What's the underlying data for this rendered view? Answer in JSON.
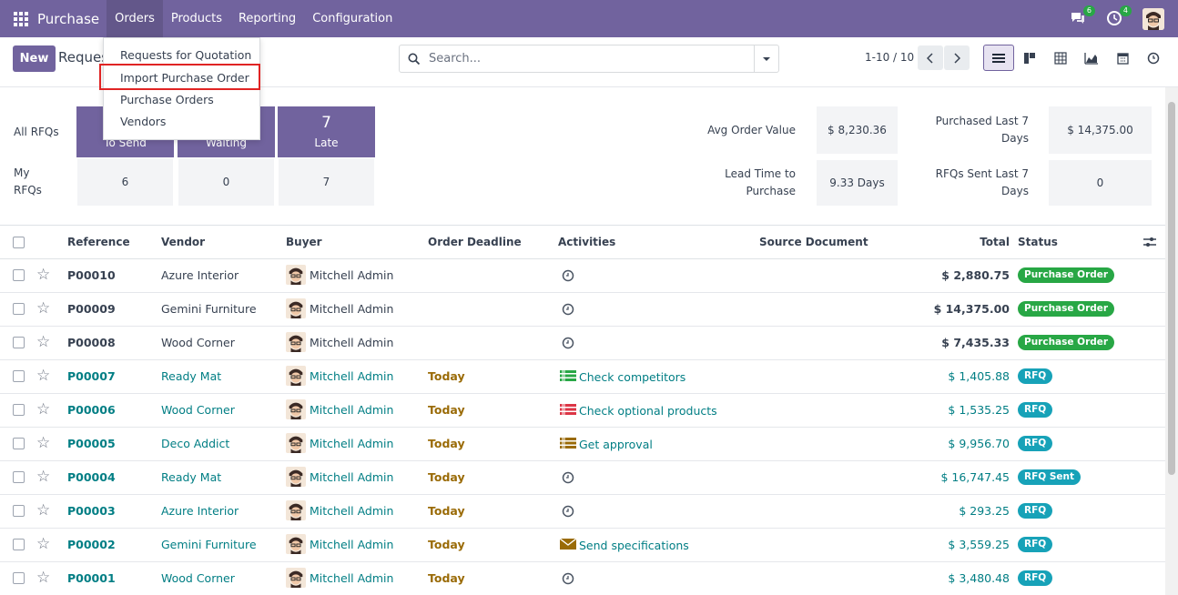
{
  "navbar": {
    "brand": "Purchase",
    "menu": [
      "Orders",
      "Products",
      "Reporting",
      "Configuration"
    ],
    "messages_count": "6",
    "activities_count": "4"
  },
  "control": {
    "new_label": "New",
    "title": "Reques",
    "search_placeholder": "Search...",
    "pager": "1-10 / 10"
  },
  "dropdown": {
    "items": [
      "Requests for Quotation",
      "Import Purchase Order",
      "Purchase Orders",
      "Vendors"
    ]
  },
  "dashboard": {
    "all_rfqs_label": "All RFQs",
    "my_rfqs_label": "My RFQs",
    "tiles": [
      {
        "count": "",
        "label": "To Send"
      },
      {
        "count": "",
        "label": "Waiting"
      },
      {
        "count": "7",
        "label": "Late"
      }
    ],
    "my_values": [
      "6",
      "0",
      "7"
    ],
    "kpis": [
      {
        "label": "Avg Order Value",
        "value": "$ 8,230.36"
      },
      {
        "label": "Purchased Last 7 Days",
        "value": "$ 14,375.00"
      },
      {
        "label": "Lead Time to Purchase",
        "value": "9.33 Days"
      },
      {
        "label": "RFQs Sent Last 7 Days",
        "value": "0"
      }
    ]
  },
  "table": {
    "headers": [
      "Reference",
      "Vendor",
      "Buyer",
      "Order Deadline",
      "Activities",
      "Source Document",
      "Total",
      "Status"
    ],
    "rows": [
      {
        "ref": "P00010",
        "vendor": "Azure Interior",
        "buyer": "Mitchell Admin",
        "deadline": "",
        "activity": "",
        "total": "$ 2,880.75",
        "status": "Purchase Order"
      },
      {
        "ref": "P00009",
        "vendor": "Gemini Furniture",
        "buyer": "Mitchell Admin",
        "deadline": "",
        "activity": "",
        "total": "$ 14,375.00",
        "status": "Purchase Order"
      },
      {
        "ref": "P00008",
        "vendor": "Wood Corner",
        "buyer": "Mitchell Admin",
        "deadline": "",
        "activity": "",
        "total": "$ 7,435.33",
        "status": "Purchase Order"
      },
      {
        "ref": "P00007",
        "vendor": "Ready Mat",
        "buyer": "Mitchell Admin",
        "deadline": "Today",
        "activity": "Check competitors",
        "total": "$ 1,405.88",
        "status": "RFQ"
      },
      {
        "ref": "P00006",
        "vendor": "Wood Corner",
        "buyer": "Mitchell Admin",
        "deadline": "Today",
        "activity": "Check optional products",
        "total": "$ 1,535.25",
        "status": "RFQ"
      },
      {
        "ref": "P00005",
        "vendor": "Deco Addict",
        "buyer": "Mitchell Admin",
        "deadline": "Today",
        "activity": "Get approval",
        "total": "$ 9,956.70",
        "status": "RFQ"
      },
      {
        "ref": "P00004",
        "vendor": "Ready Mat",
        "buyer": "Mitchell Admin",
        "deadline": "Today",
        "activity": "",
        "total": "$ 16,747.45",
        "status": "RFQ Sent"
      },
      {
        "ref": "P00003",
        "vendor": "Azure Interior",
        "buyer": "Mitchell Admin",
        "deadline": "Today",
        "activity": "",
        "total": "$ 293.25",
        "status": "RFQ"
      },
      {
        "ref": "P00002",
        "vendor": "Gemini Furniture",
        "buyer": "Mitchell Admin",
        "deadline": "Today",
        "activity": "Send specifications",
        "total": "$ 3,559.25",
        "status": "RFQ"
      },
      {
        "ref": "P00001",
        "vendor": "Wood Corner",
        "buyer": "Mitchell Admin",
        "deadline": "Today",
        "activity": "",
        "total": "$ 3,480.48",
        "status": "RFQ"
      }
    ]
  },
  "colors": {
    "brand": "#71639e",
    "link": "#017e84",
    "deadline": "#9a6b07",
    "status_po": "#28a745",
    "status_rfq": "#17a2b8"
  }
}
